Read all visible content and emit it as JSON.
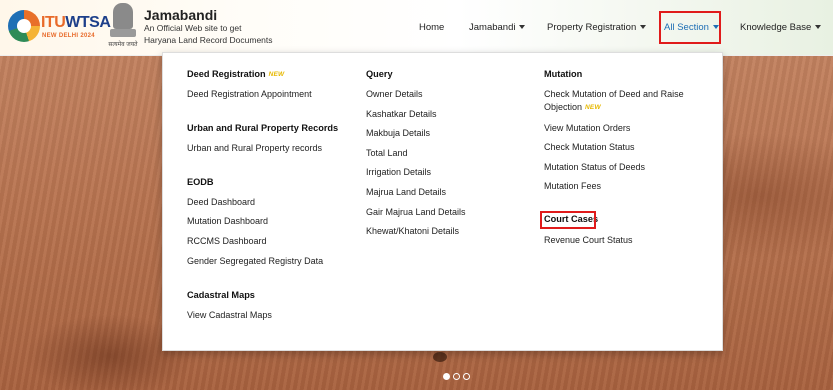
{
  "header": {
    "g20_logo": {
      "text_a": "ITU",
      "text_b": "WTSA",
      "sub": "NEW DELHI 2024"
    },
    "emblem_caption": "सत्यमेव जयते",
    "site_title": "Jamabandi",
    "site_subtitle_line1": "An Official Web site to get",
    "site_subtitle_line2": "Haryana Land Record Documents"
  },
  "nav": {
    "items": [
      {
        "label": "Home",
        "has_caret": false
      },
      {
        "label": "Jamabandi",
        "has_caret": true
      },
      {
        "label": "Property Registration",
        "has_caret": true
      },
      {
        "label": "All Section",
        "has_caret": true,
        "active": true
      },
      {
        "label": "Knowledge Base",
        "has_caret": true
      }
    ]
  },
  "dropdown": {
    "col1": {
      "deed_registration": {
        "heading": "Deed Registration",
        "badge": "NEW",
        "links": [
          "Deed Registration Appointment"
        ]
      },
      "urban_rural": {
        "heading": "Urban and Rural Property Records",
        "links": [
          "Urban and Rural Property records"
        ]
      },
      "eodb": {
        "heading": "EODB",
        "links": [
          "Deed Dashboard",
          "Mutation Dashboard",
          "RCCMS Dashboard",
          "Gender Segregated Registry Data"
        ]
      },
      "cadastral": {
        "heading": "Cadastral Maps",
        "links": [
          "View Cadastral Maps"
        ]
      }
    },
    "col2": {
      "query": {
        "heading": "Query",
        "links": [
          "Owner Details",
          "Kashatkar Details",
          "Makbuja Details",
          "Total Land",
          "Irrigation Details",
          "Majrua Land Details",
          "Gair Majrua Land Details",
          "Khewat/Khatoni Details"
        ]
      }
    },
    "col3": {
      "mutation": {
        "heading": "Mutation",
        "link1_line1": "Check Mutation of Deed and Raise",
        "link1_line2": "Objection",
        "link1_badge": "NEW",
        "links": [
          "View Mutation Orders",
          "Check Mutation Status",
          "Mutation Status of Deeds",
          "Mutation Fees"
        ]
      },
      "court_cases": {
        "heading": "Court Cases",
        "links": [
          "Revenue Court Status"
        ]
      }
    }
  },
  "carousel": {
    "slides": 3,
    "active_index": 0
  }
}
